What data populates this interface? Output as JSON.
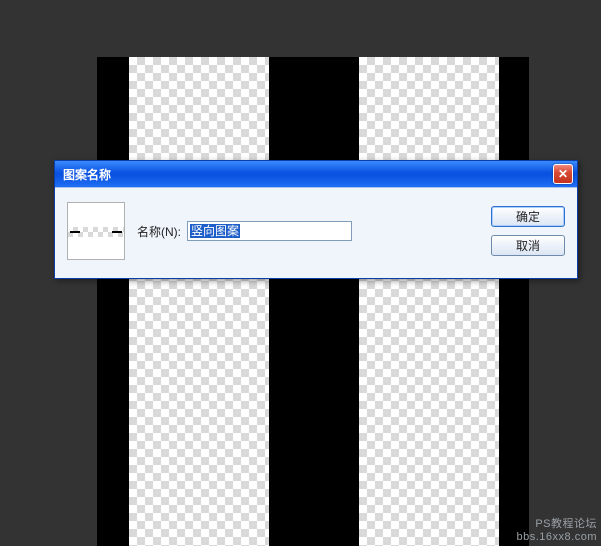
{
  "canvas": {
    "stripes": [
      "black",
      "transparent",
      "black",
      "transparent",
      "black"
    ]
  },
  "dialog": {
    "title": "图案名称",
    "close_glyph": "✕",
    "name_label": "名称(N):",
    "name_value": "竖向图案",
    "ok_label": "确定",
    "cancel_label": "取消"
  },
  "watermark": {
    "line1": "PS教程论坛",
    "line2": "bbs.16xx8.com"
  }
}
